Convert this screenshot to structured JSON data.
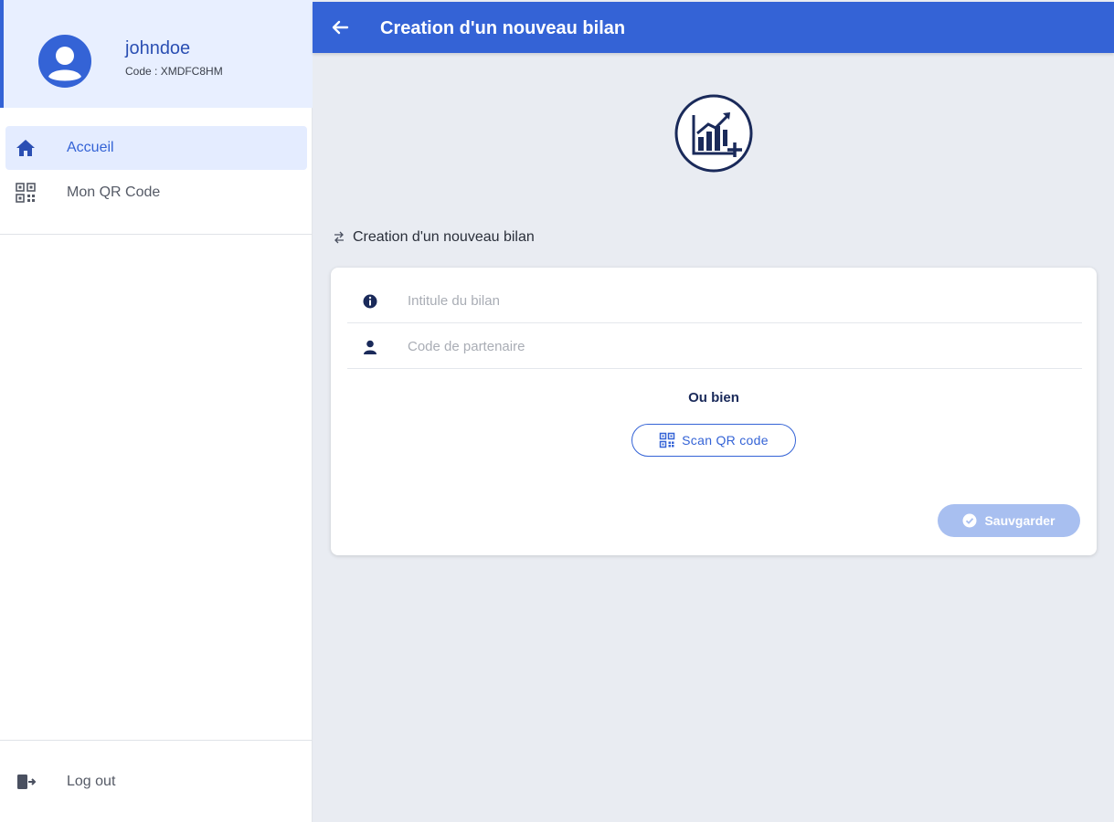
{
  "sidebar": {
    "profile": {
      "username": "johndoe",
      "code": "Code : XMDFC8HM"
    },
    "nav": [
      {
        "label": "Accueil",
        "icon": "home-icon",
        "active": true
      },
      {
        "label": "Mon QR Code",
        "icon": "qr-code-icon",
        "active": false
      }
    ],
    "logout": {
      "label": "Log out",
      "icon": "logout-icon"
    }
  },
  "header": {
    "title": "Creation d'un nouveau bilan",
    "back_icon": "arrow-left-icon"
  },
  "main": {
    "hero_icon": "chart-add-icon",
    "section_title": "Creation d'un nouveau bilan",
    "section_icon": "swap-icon",
    "form": {
      "fields": [
        {
          "placeholder": "Intitule du bilan",
          "value": "",
          "icon": "info-icon"
        },
        {
          "placeholder": "Code de partenaire",
          "value": "",
          "icon": "person-icon"
        }
      ],
      "or_label": "Ou bien",
      "scan_button": {
        "label": "Scan QR code",
        "icon": "qr-code-icon"
      },
      "save_button": {
        "label": "Sauvgarder",
        "icon": "check-circle-icon",
        "disabled": true
      }
    }
  },
  "colors": {
    "primary": "#3463d6",
    "primary_light": "#e8efff",
    "background": "#e9ecf2",
    "disabled_button": "#a8bff0",
    "navy": "#1a2a5a"
  }
}
